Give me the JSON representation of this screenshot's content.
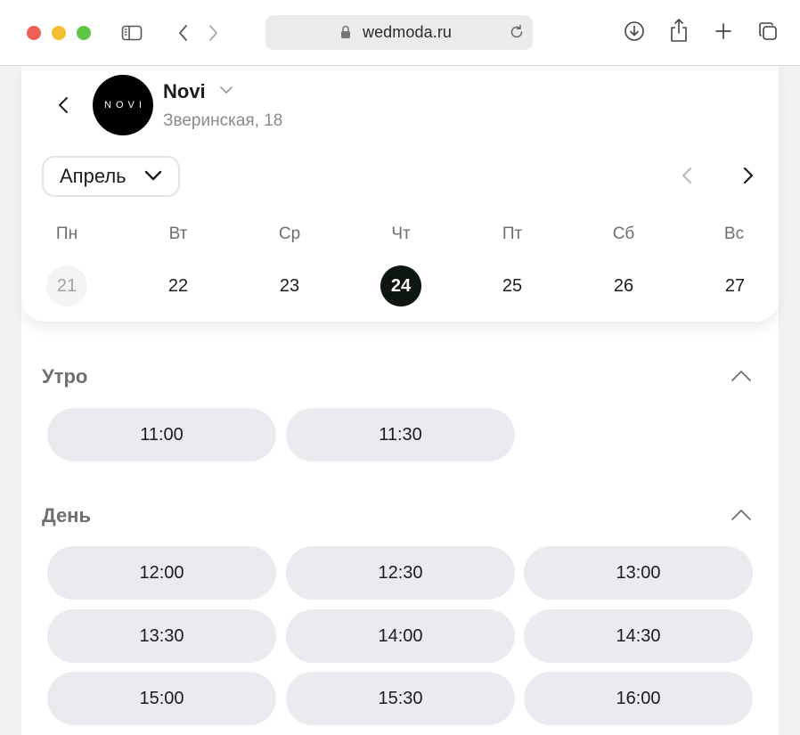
{
  "browser": {
    "url": "wedmoda.ru"
  },
  "salon": {
    "avatar_text": "NOVI",
    "name": "Novi",
    "address": "Зверинская, 18"
  },
  "calendar": {
    "month": "Апрель",
    "weekdays": [
      "Пн",
      "Вт",
      "Ср",
      "Чт",
      "Пт",
      "Сб",
      "Вс"
    ],
    "days": [
      "21",
      "22",
      "23",
      "24",
      "25",
      "26",
      "27"
    ],
    "past_day": "21",
    "selected_day": "24"
  },
  "sections": {
    "morning": {
      "title": "Утро",
      "slots": [
        "11:00",
        "11:30"
      ]
    },
    "day": {
      "title": "День",
      "slots": [
        "12:00",
        "12:30",
        "13:00",
        "13:30",
        "14:00",
        "14:30",
        "15:00",
        "15:30",
        "16:00"
      ]
    }
  },
  "colors": {
    "selected_day_bg": "#0d1710",
    "slot_bg": "#e9ebef",
    "muted_text": "#6e6e73"
  }
}
